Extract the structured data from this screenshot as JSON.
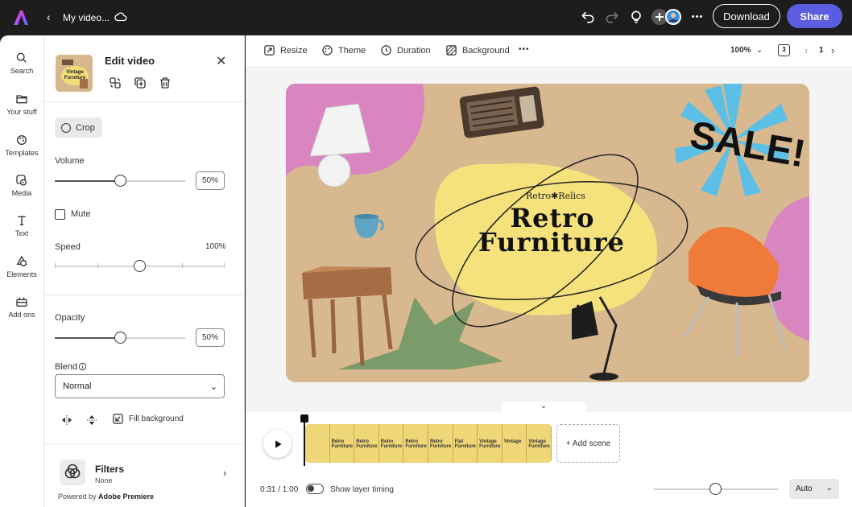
{
  "topbar": {
    "back_label": "‹",
    "file_title": "My video...",
    "more_label": "•••",
    "download_label": "Download",
    "share_label": "Share"
  },
  "rail": {
    "items": [
      {
        "label": "Search",
        "icon": "search-icon"
      },
      {
        "label": "Your stuff",
        "icon": "folder-icon"
      },
      {
        "label": "Templates",
        "icon": "templates-icon"
      },
      {
        "label": "Media",
        "icon": "media-icon"
      },
      {
        "label": "Text",
        "icon": "text-icon"
      },
      {
        "label": "Elements",
        "icon": "elements-icon"
      },
      {
        "label": "Add ons",
        "icon": "add-ons-icon"
      }
    ]
  },
  "panel": {
    "title": "Edit video",
    "thumb_text": "Vintage Furniture",
    "crop_label": "Crop",
    "volume_label": "Volume",
    "volume_value": "50%",
    "volume_fraction": 0.5,
    "mute_label": "Mute",
    "speed_label": "Speed",
    "speed_value": "100%",
    "opacity_label": "Opacity",
    "opacity_value": "50%",
    "opacity_fraction": 0.5,
    "blend_label": "Blend",
    "blend_value": "Normal",
    "fill_background_label": "Fill background",
    "filters_label": "Filters",
    "filters_value": "None",
    "powered_prefix": "Powered by ",
    "powered_brand": "Adobe Premiere"
  },
  "toolbar": {
    "resize_label": "Resize",
    "theme_label": "Theme",
    "duration_label": "Duration",
    "background_label": "Background",
    "more_label": "•••",
    "zoom_value": "100%",
    "page_count_badge": "3",
    "page_number": "1"
  },
  "canvas": {
    "brand_line": "Retro✱Relics",
    "headline_1": "Retro",
    "headline_2": "Furniture",
    "sale_text": "SALE!"
  },
  "timeline": {
    "frames": [
      {
        "l1": "",
        "l2": ""
      },
      {
        "l1": "Retro",
        "l2": "Furniture"
      },
      {
        "l1": "Retro",
        "l2": "Furniture"
      },
      {
        "l1": "Retro",
        "l2": "Furniture"
      },
      {
        "l1": "Retro",
        "l2": "Furniture"
      },
      {
        "l1": "Retro",
        "l2": "Furniture"
      },
      {
        "l1": "Flat",
        "l2": "Furniture"
      },
      {
        "l1": "Vintage",
        "l2": "Furniture"
      },
      {
        "l1": "Vintage",
        "l2": ""
      },
      {
        "l1": "Vintage",
        "l2": "Furniture"
      }
    ],
    "add_scene_label": "+ Add scene",
    "time_display": "0:31 / 1:00",
    "show_layer_timing_label": "Show layer timing",
    "auto_label": "Auto"
  },
  "colors": {
    "share_bg": "#5c5ce0",
    "canvas_bg": "#d6b48a",
    "blob_yellow": "#f5e27c",
    "blob_pink": "#d985c0",
    "sunburst_blue": "#5cc0e6",
    "chair_orange": "#ef7a3a"
  }
}
